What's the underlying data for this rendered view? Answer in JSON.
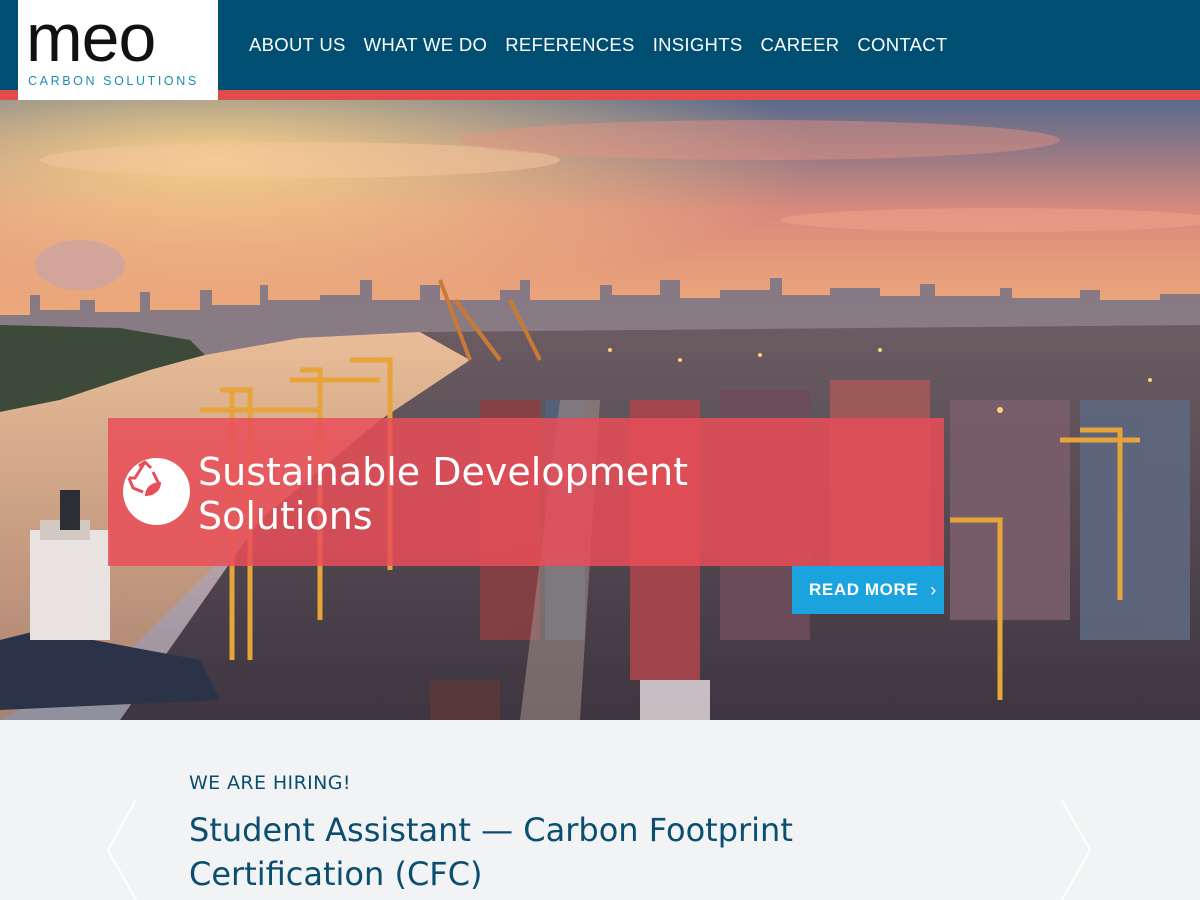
{
  "logo": {
    "wordmark": "meo",
    "tagline": "CARBON SOLUTIONS"
  },
  "nav": {
    "items": [
      "ABOUT US",
      "WHAT WE DO",
      "REFERENCES",
      "INSIGHTS",
      "CAREER",
      "CONTACT"
    ]
  },
  "hero": {
    "banner_line1": "Sustainable Development",
    "banner_line2": "Solutions",
    "cta_label": "READ MORE",
    "icon": "recycle-leaf-icon"
  },
  "hiring": {
    "eyebrow": "WE ARE HIRING!",
    "title_line1": "Student Assistant — Carbon Footprint",
    "title_line2": "Certification (CFC)"
  },
  "colors": {
    "header": "#004e72",
    "accent_red": "#e04b4b",
    "banner": "#e84e58",
    "cta": "#1aa3dd",
    "text_dark_blue": "#0c4e6f"
  }
}
